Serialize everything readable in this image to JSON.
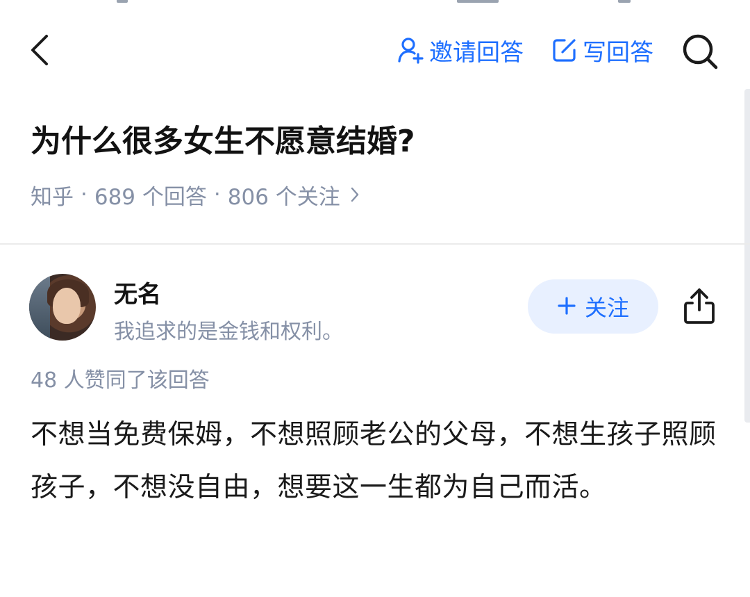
{
  "topbar": {
    "invite_label": "邀请回答",
    "write_label": "写回答"
  },
  "question": {
    "title": "为什么很多女生不愿意结婚?",
    "source": "知乎",
    "answers_count": "689 个回答",
    "followers_count": "806 个关注",
    "separator": "·"
  },
  "answer": {
    "author_name": "无名",
    "author_bio": "我追求的是金钱和权利。",
    "follow_label": "关注",
    "vote_summary": "48 人赞同了该回答",
    "content": "不想当免费保姆，不想照顾老公的父母，不想生孩子照顾孩子，不想没自由，想要这一生都为自己而活。"
  },
  "colors": {
    "accent": "#1e6fff",
    "meta": "#8590a6",
    "follow_bg": "#e8f0ff",
    "divider": "#ebebeb"
  },
  "icons": {
    "back": "chevron-left-icon",
    "invite": "user-plus-icon",
    "write": "edit-icon",
    "search": "search-icon",
    "more": "chevron-right-icon",
    "share": "share-icon",
    "follow": "plus-icon"
  }
}
